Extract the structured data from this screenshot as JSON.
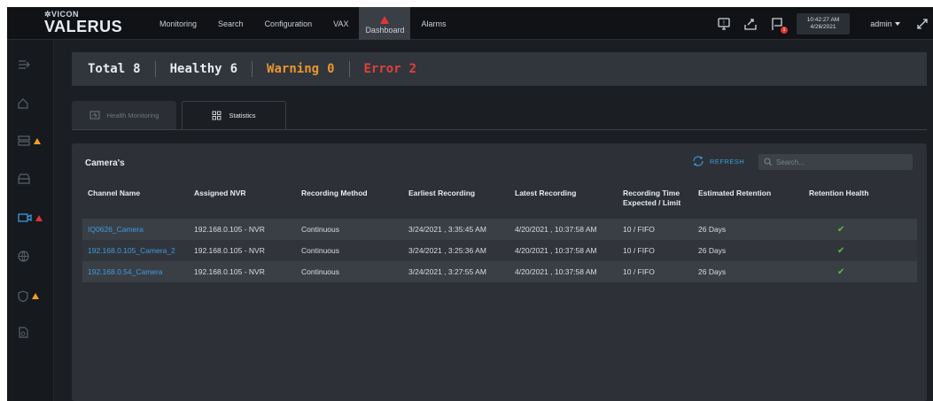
{
  "app": {
    "brand_small": "✲VICON",
    "brand_big": "VALERUS"
  },
  "nav": [
    {
      "label": "Monitoring"
    },
    {
      "label": "Search"
    },
    {
      "label": "Configuration"
    },
    {
      "label": "VAX"
    },
    {
      "label": "Dashboard",
      "active": true
    },
    {
      "label": "Alarms"
    }
  ],
  "header": {
    "time": "10:42:27 AM",
    "date": "4/26/2021",
    "user": "admin",
    "notification_count": "1",
    "icons": [
      "monitor-alert-icon",
      "export-icon",
      "flag-icon",
      "expand-icon"
    ]
  },
  "sidebar": {
    "icons": [
      "collapse-menu-icon",
      "home-icon",
      "storage-icon",
      "server-icon",
      "camera-icon",
      "network-icon",
      "shield-icon",
      "report-icon"
    ],
    "warnings": {
      "storage": "warning",
      "camera": "error",
      "shield": "warning"
    }
  },
  "summary": {
    "total_label": "Total",
    "total_value": "8",
    "healthy_label": "Healthy",
    "healthy_value": "6",
    "warning_label": "Warning",
    "warning_value": "0",
    "error_label": "Error",
    "error_value": "2",
    "colors": {
      "warning": "#e9962f",
      "error": "#e0413b"
    }
  },
  "tabs": [
    {
      "label": "Health Monitoring",
      "active": false
    },
    {
      "label": "Statistics",
      "active": true
    }
  ],
  "panel": {
    "title": "Camera's",
    "refresh_label": "REFRESH",
    "search_placeholder": "Search..."
  },
  "table": {
    "headers": [
      "Channel Name",
      "Assigned NVR",
      "Recording Method",
      "Earliest Recording",
      "Latest Recording",
      "Recording Time Expected / Limit",
      "Estimated Retention",
      "Retention Health"
    ],
    "rows": [
      [
        "IQ0626_Camera",
        "192.168.0.105 - NVR",
        "Continuous",
        "3/24/2021 , 3:35:45 AM",
        "4/20/2021 , 10:37:58 AM",
        "10 / FIFO",
        "26 Days",
        "✔"
      ],
      [
        "192.168.0.105_Camera_2",
        "192.168.0.105 - NVR",
        "Continuous",
        "3/24/2021 , 3:25:36 AM",
        "4/20/2021 , 10:37:58 AM",
        "10 / FIFO",
        "26 Days",
        "✔"
      ],
      [
        "192.168.0.54_Camera",
        "192.168.0.105 - NVR",
        "Continuous",
        "3/24/2021 , 3:27:55 AM",
        "4/20/2021 , 10:37:58 AM",
        "10 / FIFO",
        "26 Days",
        "✔"
      ]
    ]
  }
}
